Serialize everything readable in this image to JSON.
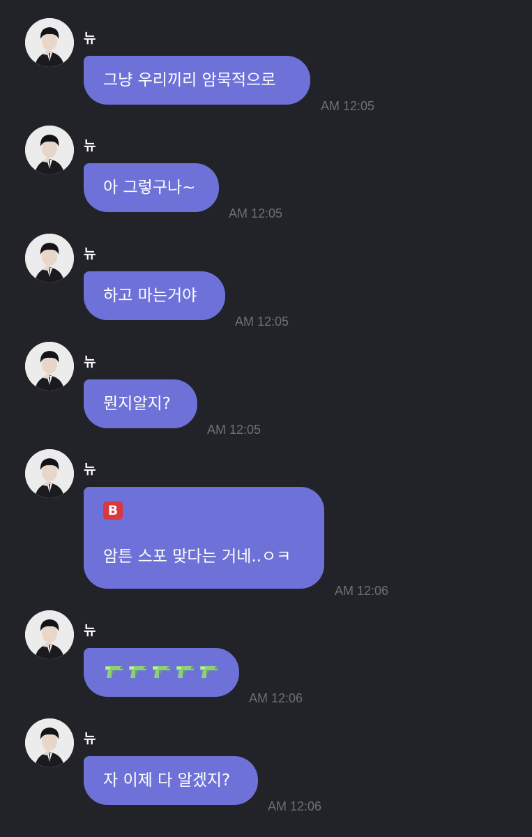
{
  "colors": {
    "background": "#222229",
    "bubble": "#6e72d8",
    "timestamp": "#6f6f78",
    "badge": "#d9383c"
  },
  "messages": [
    {
      "sender": "뉴",
      "text": "그냥 우리끼리 암묵적으로",
      "time": "AM 12:05"
    },
    {
      "sender": "뉴",
      "text": "아 그렇구나~",
      "time": "AM 12:05"
    },
    {
      "sender": "뉴",
      "text": "하고 마는거야",
      "time": "AM 12:05"
    },
    {
      "sender": "뉴",
      "text": "뭔지알지?",
      "time": "AM 12:05"
    },
    {
      "sender": "뉴",
      "badge": "B",
      "text": "암튼 스포 맞다는 거네..ㅇㅋ",
      "time": "AM 12:06"
    },
    {
      "sender": "뉴",
      "emoji": [
        "water-pistol-icon",
        "water-pistol-icon",
        "water-pistol-icon",
        "water-pistol-icon",
        "water-pistol-icon"
      ],
      "time": "AM 12:06"
    },
    {
      "sender": "뉴",
      "text": "자 이제 다 알겠지?",
      "time": "AM 12:06"
    }
  ]
}
